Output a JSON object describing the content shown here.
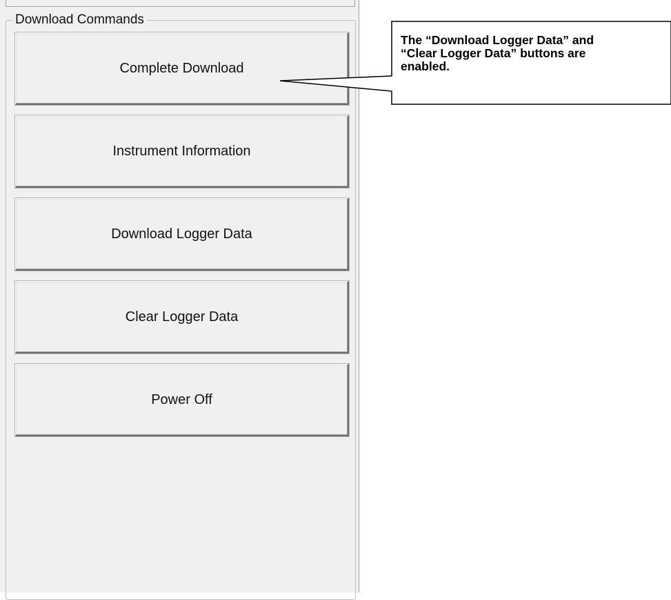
{
  "group": {
    "title": "Download Commands"
  },
  "buttons": [
    {
      "label": "Complete Download"
    },
    {
      "label": "Instrument Information"
    },
    {
      "label": "Download Logger Data"
    },
    {
      "label": "Clear Logger Data"
    },
    {
      "label": "Power Off"
    }
  ],
  "callout": {
    "lines": [
      "The “Download Logger Data” and",
      "“Clear Logger Data” buttons are",
      "enabled."
    ]
  }
}
